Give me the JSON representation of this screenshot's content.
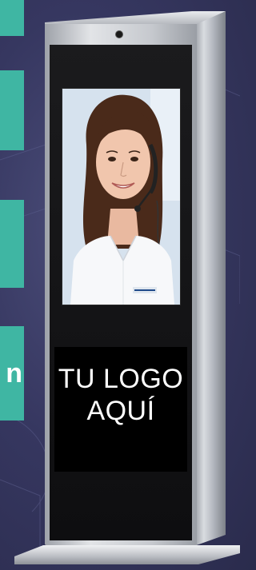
{
  "kiosk": {
    "screen_image": "woman-with-headset-photo",
    "logo_placeholder": {
      "line1": "TU LOGO",
      "line2": "AQUÍ"
    }
  },
  "colors": {
    "background": "#363760",
    "accent_teal": "#3fb6a3",
    "panel_black": "#0e0e10",
    "steel": "#c6c9ce",
    "text_white": "#ffffff"
  }
}
